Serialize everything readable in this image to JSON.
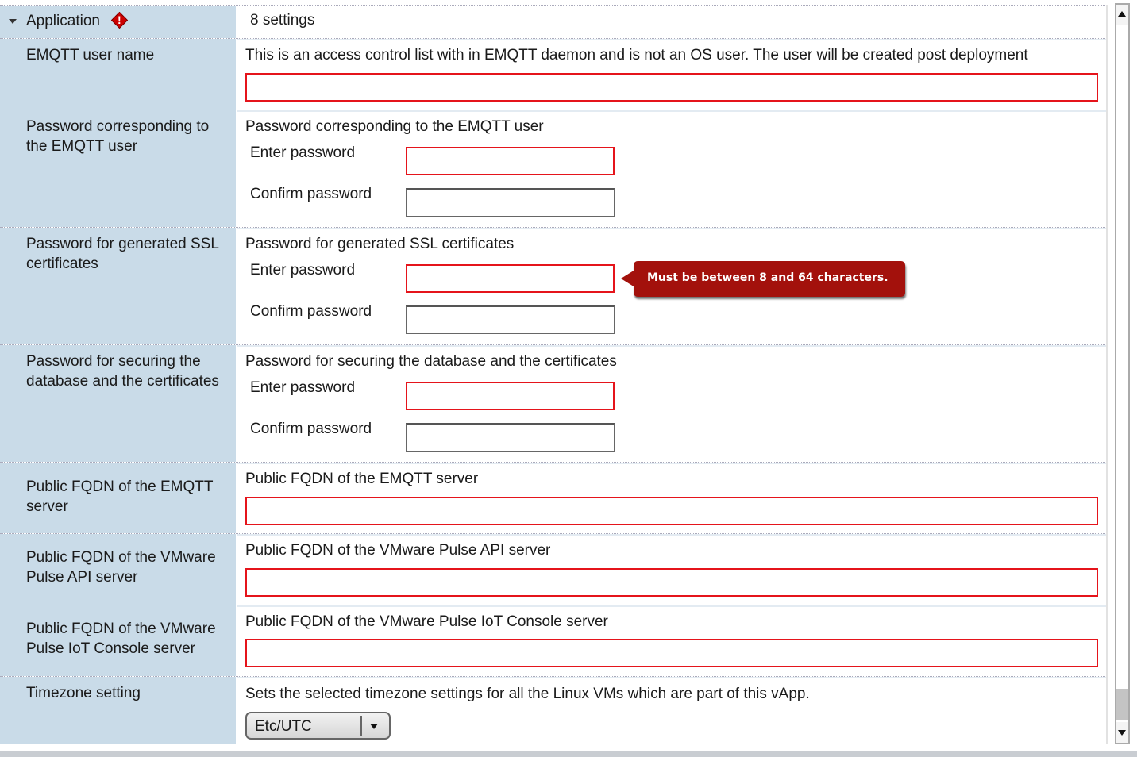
{
  "section": {
    "title": "Application",
    "count": "8 settings",
    "icon": "error-diamond-icon"
  },
  "settings": [
    {
      "label": "EMQTT user name",
      "description": "This is an access control list with in EMQTT daemon and is not an OS user. The user will be created post deployment",
      "value": ""
    },
    {
      "label": "Password corresponding to the EMQTT user",
      "description": "Password corresponding to the EMQTT user",
      "enter_label": "Enter password",
      "confirm_label": "Confirm password"
    },
    {
      "label": "Password for generated SSL certificates",
      "description": "Password for generated SSL certificates",
      "enter_label": "Enter password",
      "confirm_label": "Confirm password",
      "error": "Must be between 8 and 64 characters."
    },
    {
      "label": "Password for securing the database and the certificates",
      "description": "Password for securing the database and the certificates",
      "enter_label": "Enter password",
      "confirm_label": "Confirm password"
    },
    {
      "label": "Public FQDN of the EMQTT server",
      "description": "Public FQDN of the EMQTT server",
      "value": ""
    },
    {
      "label": "Public FQDN of the VMware Pulse API server",
      "description": "Public FQDN of the VMware Pulse API server",
      "value": ""
    },
    {
      "label": "Public FQDN of the VMware Pulse IoT Console server",
      "description": "Public FQDN of the VMware Pulse IoT Console server",
      "value": ""
    },
    {
      "label": "Timezone setting",
      "description": "Sets the selected timezone settings for all the Linux VMs which are part of this vApp.",
      "selected": "Etc/UTC"
    }
  ],
  "colors": {
    "error": "#e5141b",
    "tooltip": "#a3110c",
    "label_bg": "#c9dbe8"
  }
}
